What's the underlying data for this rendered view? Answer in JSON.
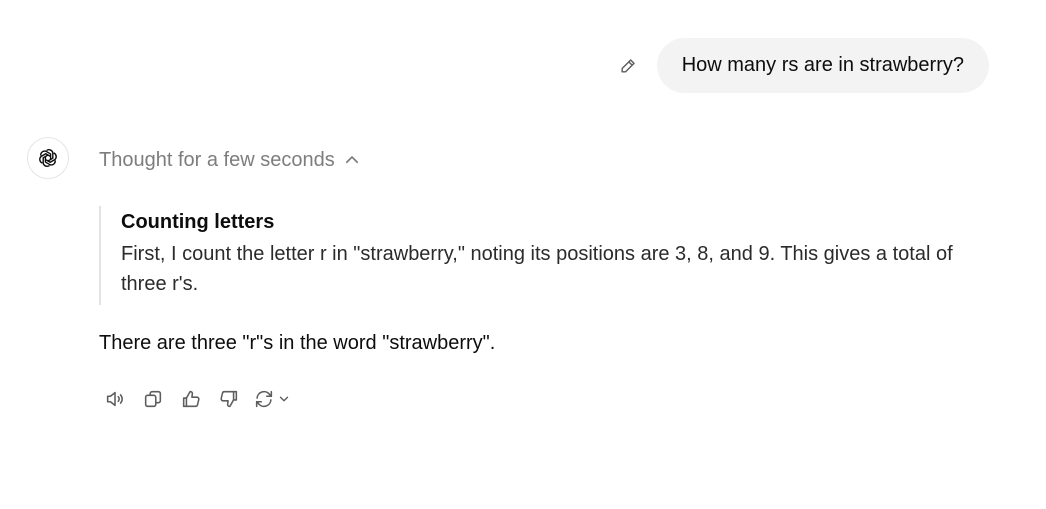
{
  "user_message": {
    "text": "How many rs are in strawberry?",
    "edit_icon": "pencil-icon"
  },
  "assistant": {
    "avatar_icon": "openai-logo-icon",
    "thought_toggle": {
      "label": "Thought for a few seconds",
      "icon": "chevron-up-icon"
    },
    "reasoning": {
      "title": "Counting letters",
      "text": "First, I count the letter r in \"strawberry,\" noting its positions are 3, 8, and 9. This gives a total of three r's."
    },
    "answer": "There are three \"r\"s in the word \"strawberry\"."
  },
  "actions": [
    {
      "name": "read-aloud",
      "icon": "speaker-icon"
    },
    {
      "name": "copy",
      "icon": "copy-icon"
    },
    {
      "name": "good-response",
      "icon": "thumbs-up-icon"
    },
    {
      "name": "bad-response",
      "icon": "thumbs-down-icon"
    },
    {
      "name": "regenerate",
      "icon": "refresh-icon"
    }
  ],
  "colors": {
    "bubble_bg": "#f3f3f3",
    "muted_text": "#7d7d7d",
    "border": "#e3e3e3"
  }
}
